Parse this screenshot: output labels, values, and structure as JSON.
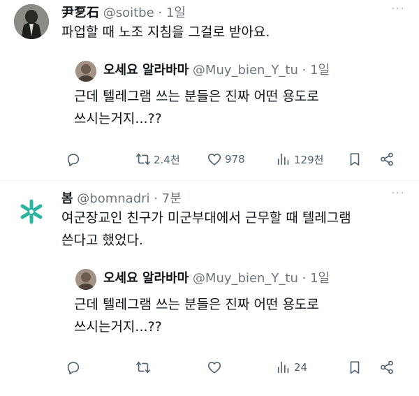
{
  "tweets": [
    {
      "author": {
        "name": "尹乭石",
        "handle": "@soitbe",
        "time": "1일"
      },
      "text": "파업할 때 노조 지침을 그걸로 받아요.",
      "quote": {
        "author": {
          "name": "오세요 알라바마",
          "handle": "@Muy_bien_Y_tu",
          "time": "1일"
        },
        "text_lines": [
          "근데 텔레그램 쓰는 분들은 진짜 어떤 용도로",
          "쓰시는거지...??"
        ]
      },
      "actions": {
        "reply": "",
        "retweet": "2.4천",
        "like": "978",
        "views": "129천"
      }
    },
    {
      "author": {
        "name": "봄",
        "handle": "@bomnadri",
        "time": "7분"
      },
      "text_lines": [
        "여군장교인 친구가 미군부대에서 근무할 때 텔레그램",
        "쓴다고 했었다."
      ],
      "quote": {
        "author": {
          "name": "오세요 알라바마",
          "handle": "@Muy_bien_Y_tu",
          "time": "1일"
        },
        "text_lines": [
          "근데 텔레그램 쓰는 분들은 진짜 어떤 용도로",
          "쓰시는거지...??"
        ]
      },
      "actions": {
        "reply": "",
        "retweet": "",
        "like": "",
        "views": "24"
      }
    }
  ],
  "ui": {
    "more_glyph": "···",
    "dot": "·",
    "icons": [
      "reply-icon",
      "retweet-icon",
      "like-icon",
      "views-icon",
      "bookmark-icon",
      "share-icon",
      "more-icon"
    ],
    "accent_avatar_color": "#2bb5a0"
  }
}
